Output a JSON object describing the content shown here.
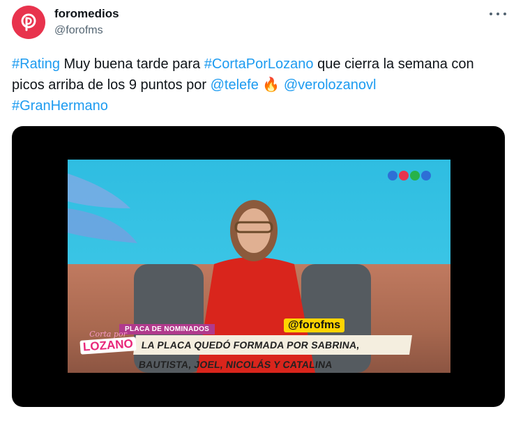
{
  "author": {
    "display_name": "foromedios",
    "handle": "@forofms",
    "avatar_icon": "foromedios-logo-icon",
    "avatar_color": "#e8334d"
  },
  "tweet": {
    "parts": [
      {
        "text": "#Rating",
        "link": true
      },
      {
        "text": " Muy buena tarde para ",
        "link": false
      },
      {
        "text": "#CortaPorLozano",
        "link": true
      },
      {
        "text": " que cierra la semana con picos arriba de los 9 puntos por ",
        "link": false
      },
      {
        "text": "@telefe",
        "link": true
      },
      {
        "text": " 🔥 ",
        "link": false
      },
      {
        "text": "@verolozanovl",
        "link": true
      },
      {
        "text": "#GranHermano",
        "link": true
      }
    ]
  },
  "media": {
    "lower_third_tag": "PLACA DE NOMINADOS",
    "lower_third_text": "LA PLACA QUEDÓ FORMADA POR SABRINA, BAUTISTA, JOEL, NICOLÁS Y CATALINA",
    "watermark": "@forofms",
    "show_logo_top": "Corta por",
    "show_logo_bottom": "LOZANO",
    "channel_logo_colors": [
      "#2d6fd6",
      "#e8334d",
      "#27b24a",
      "#2d6fd6"
    ]
  },
  "ui": {
    "more_icon": "more-horizontal-icon",
    "link_color": "#1d9bf0"
  }
}
